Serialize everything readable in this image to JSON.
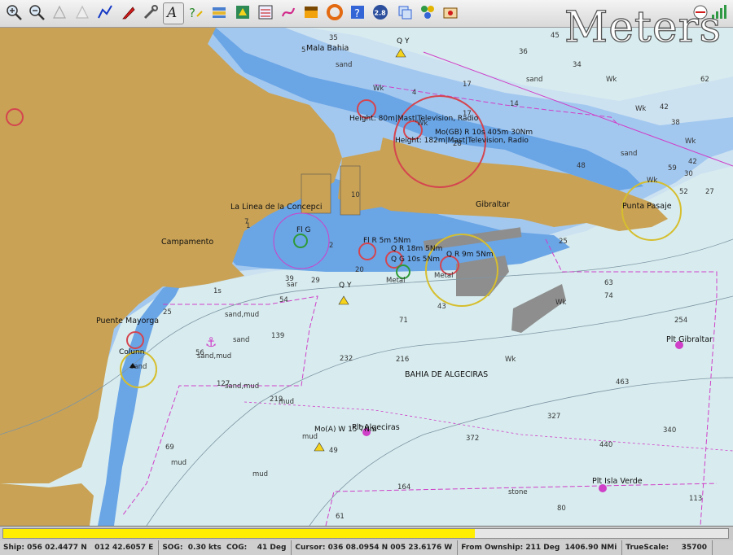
{
  "toolbar": {
    "buttons": [
      {
        "name": "zoom-in-icon"
      },
      {
        "name": "zoom-out-icon"
      },
      {
        "name": "scale-in-icon"
      },
      {
        "name": "scale-out-icon"
      },
      {
        "name": "route-icon"
      },
      {
        "name": "follow-ship-icon"
      },
      {
        "name": "settings-icon"
      },
      {
        "name": "text-toggle-icon"
      },
      {
        "name": "current-tide-icon"
      },
      {
        "name": "layers-icon"
      },
      {
        "name": "ais-targets-icon"
      },
      {
        "name": "route-manager-icon"
      },
      {
        "name": "track-icon"
      },
      {
        "name": "color-scheme-icon"
      },
      {
        "name": "mob-icon"
      },
      {
        "name": "help-icon"
      },
      {
        "name": "version-icon",
        "label": "2.8"
      },
      {
        "name": "chart-group-icon"
      },
      {
        "name": "plugins-icon"
      },
      {
        "name": "print-icon"
      }
    ]
  },
  "units_label": "Meters",
  "chart": {
    "places": [
      "Mala Bahia",
      "La Linea de la Concepci",
      "Campamento",
      "Gibraltar",
      "Punta Pasaje",
      "Puente Mayorga",
      "BAHIA DE ALGECIRAS",
      "Plt Gibraltar",
      "Plt Algeciras",
      "Plt Isla Verde"
    ],
    "lights": [
      "Height: 80m|Mast|Television, Radio",
      "Mo(GB) R 10s 405m 30Nm",
      "Height: 182m|Mast|Television, Radio",
      "Fl G",
      "Fl R 5m 5Nm",
      "Q R 18m 5Nm",
      "Q G 10s 5Nm",
      "Q R 9m 5Nm",
      "Q Y",
      "Q Y",
      "Colunn",
      "Mo(A) W 15 7Nm"
    ],
    "seabed": [
      "sand",
      "sand",
      "sand",
      "sand",
      "sand,mud",
      "sand,mud",
      "sand,mud",
      "sand",
      "mud",
      "mud",
      "mud",
      "mud",
      "stone",
      "Metal",
      "Metal",
      "sar",
      "Wk",
      "Wk",
      "Wk",
      "Wk",
      "Wk",
      "Wk",
      "Wk",
      "Wk"
    ],
    "depths": [
      "45",
      "36",
      "34",
      "62",
      "17",
      "17",
      "42",
      "38",
      "52",
      "27",
      "5",
      "4",
      "48",
      "30",
      "25",
      "59",
      "42",
      "39",
      "54",
      "29",
      "20",
      "49",
      "25",
      "56",
      "35",
      "127",
      "139",
      "232",
      "219",
      "71",
      "43",
      "63",
      "74",
      "216",
      "463",
      "254",
      "327",
      "340",
      "372",
      "440",
      "69",
      "164",
      "113",
      "61",
      "80",
      "7",
      "1",
      "10",
      "14",
      "2",
      "28",
      "1s"
    ]
  },
  "status": {
    "progress": 0.65,
    "ship": "Ship: 056 02.4477 N   012 42.6057 E",
    "sog": "SOG:  0.30 kts  COG:    41 Deg",
    "cursor": "Cursor: 036 08.0954 N 005 23.6176 W",
    "from_ownship": "From Ownship: 211 Deg  1406.90 NMi",
    "truescale": "TrueScale:     35700"
  },
  "colors": {
    "land": "#c9a255",
    "shallow": "#6aa5e6",
    "medium": "#a3c8ef",
    "light": "#cde2f1",
    "deep": "#d8ecef",
    "restricted": "#cf3fc8",
    "light_ring": "#d4454f",
    "sector_yellow": "#d6be2e",
    "progress": "#ffee00"
  }
}
